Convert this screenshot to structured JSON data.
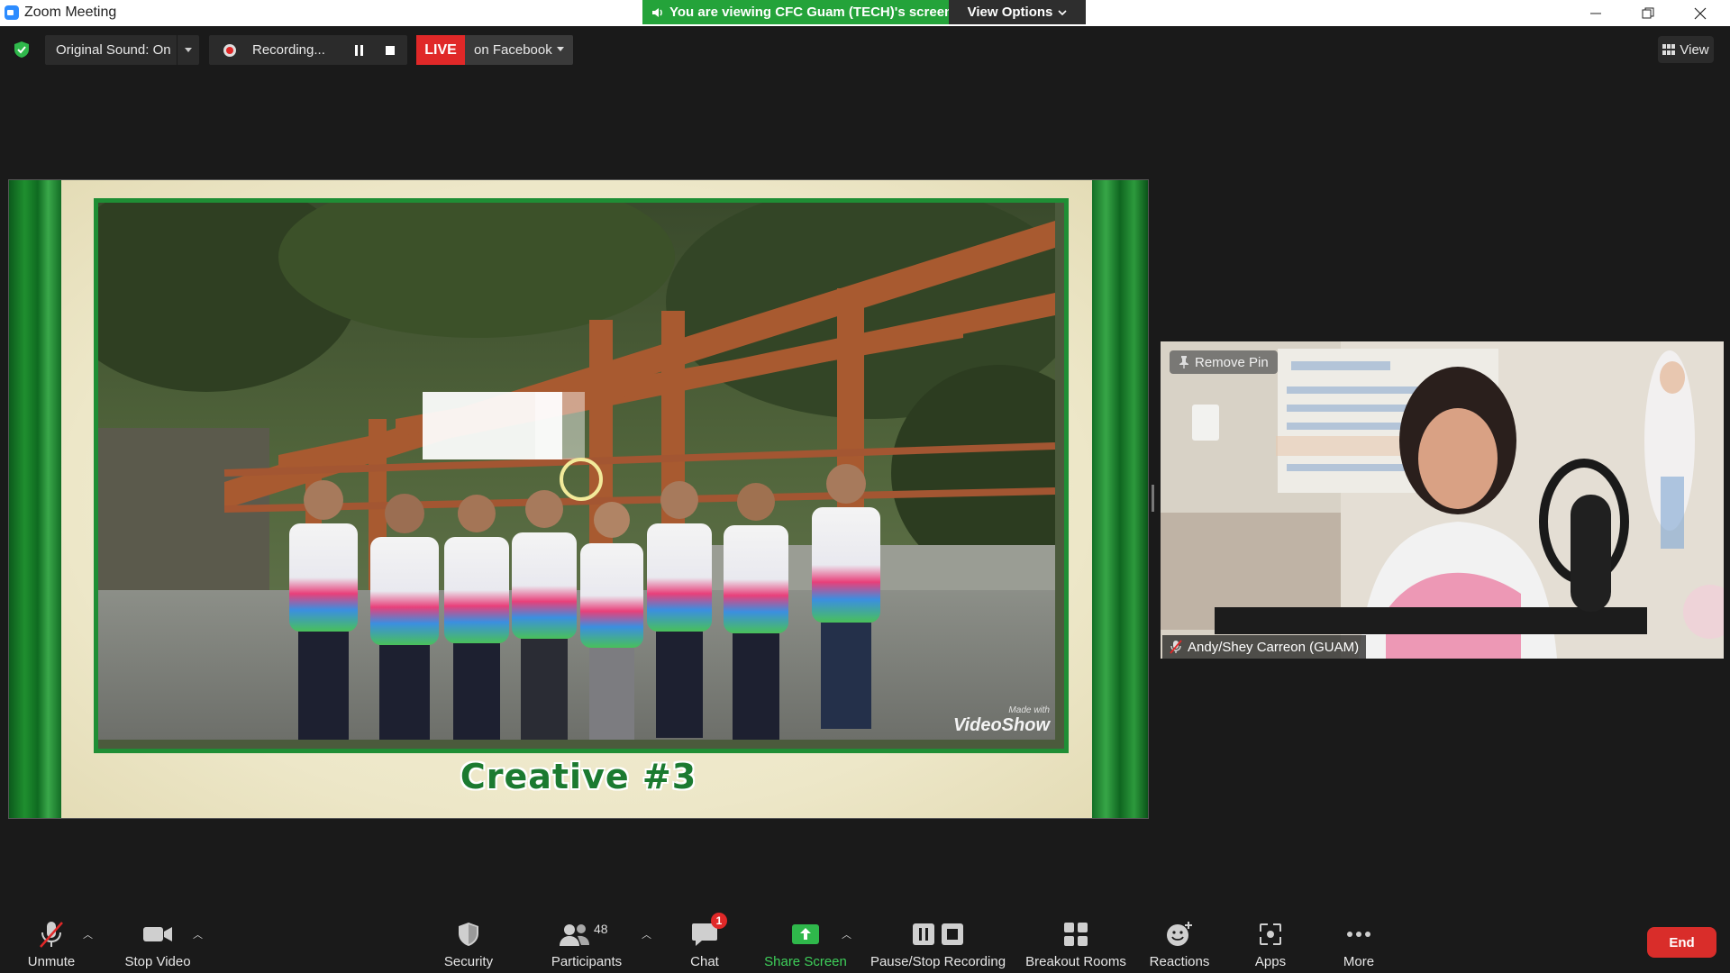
{
  "window": {
    "title": "Zoom Meeting"
  },
  "banner": {
    "text": "You are viewing CFC Guam (TECH)'s screen",
    "view_options": "View Options"
  },
  "top_toolbar": {
    "original_sound": "Original Sound: On",
    "recording": "Recording...",
    "live_badge": "LIVE",
    "live_target": "on Facebook",
    "view": "View"
  },
  "shared_screen": {
    "slide_title": "Creative #3",
    "watermark_small": "Made with",
    "watermark_brand": "VideoShow"
  },
  "participant": {
    "remove_pin": "Remove Pin",
    "name": "Andy/Shey Carreon (GUAM)",
    "muted": true
  },
  "bottom_bar": {
    "unmute": "Unmute",
    "stop_video": "Stop Video",
    "security": "Security",
    "participants": "Participants",
    "participants_count": "48",
    "chat": "Chat",
    "chat_badge": "1",
    "share_screen": "Share Screen",
    "pause_stop_recording": "Pause/Stop Recording",
    "breakout_rooms": "Breakout Rooms",
    "reactions": "Reactions",
    "apps": "Apps",
    "more": "More",
    "end": "End"
  },
  "colors": {
    "accent_green": "#24a33a",
    "end_red": "#d92d2a",
    "live_red": "#e02828",
    "frame_green": "#1f8e35"
  }
}
